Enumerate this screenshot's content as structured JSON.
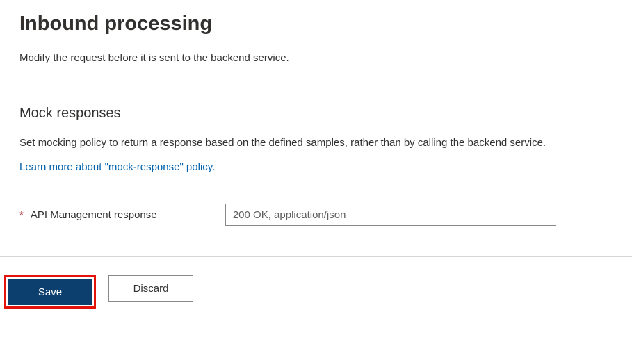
{
  "header": {
    "title": "Inbound processing",
    "subtitle": "Modify the request before it is sent to the backend service."
  },
  "mock": {
    "heading": "Mock responses",
    "description": "Set mocking policy to return a response based on the defined samples, rather than by calling the backend service.",
    "learn_more_text": "Learn more about \"mock-response\" policy.",
    "field_label": "API Management response",
    "field_value": "200 OK, application/json"
  },
  "buttons": {
    "save": "Save",
    "discard": "Discard"
  }
}
